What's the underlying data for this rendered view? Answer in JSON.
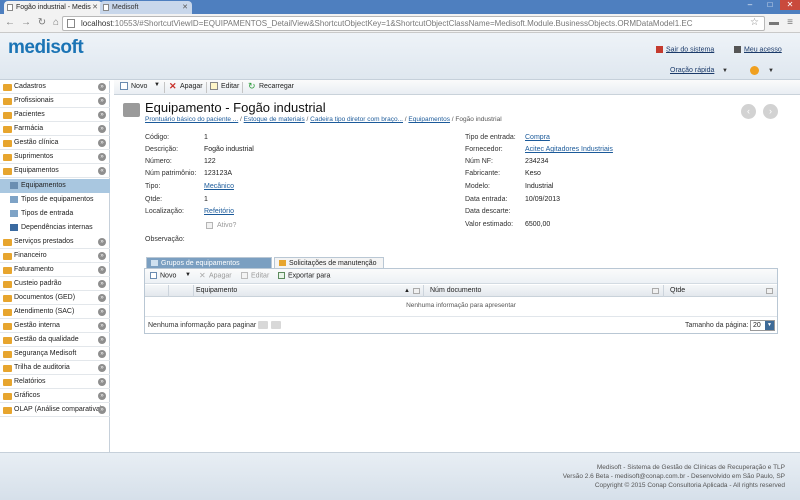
{
  "browser": {
    "tabs": [
      {
        "label": "Fogão industrial - Medis"
      },
      {
        "label": "Medisoft"
      }
    ],
    "url_host": "localhost",
    "url_rest": ":10553/#ShortcutViewID=EQUIPAMENTOS_DetailView&ShortcutObjectKey=1&ShortcutObjectClassName=Medisoft.Module.BusinessObjects.ORMDataModel1.EC"
  },
  "header": {
    "logo": "medisoft",
    "logout": "Sair do sistema",
    "account": "Meu acesso",
    "quick_prayer": "Oração rápida"
  },
  "sidebar": {
    "groups_top": [
      "Cadastros",
      "Profissionais",
      "Pacientes",
      "Farmácia",
      "Gestão clínica",
      "Suprimentos",
      "Equipamentos"
    ],
    "sub_items": [
      {
        "label": "Equipamentos",
        "selected": true
      },
      {
        "label": "Tipos de equipamentos",
        "selected": false
      },
      {
        "label": "Tipos de entrada",
        "selected": false
      },
      {
        "label": "Dependências internas",
        "selected": false
      }
    ],
    "groups_bottom": [
      "Serviços prestados",
      "Financeiro",
      "Faturamento",
      "Custeio padrão",
      "Documentos (GED)",
      "Atendimento (SAC)",
      "Gestão interna",
      "Gestão da qualidade",
      "Segurança Medisoft",
      "Trilha de auditoria",
      "Relatórios",
      "Gráficos",
      "OLAP (Análise comparativa)"
    ]
  },
  "toolbar": {
    "new": "Novo",
    "delete": "Apagar",
    "edit": "Editar",
    "reload": "Recarregar"
  },
  "page": {
    "title": "Equipamento - Fogão industrial",
    "breadcrumb": [
      "Prontuário básico do paciente ...",
      "Estoque de materiais",
      "Cadeira tipo diretor com braço...",
      "Equipamentos"
    ],
    "breadcrumb_current": "Fogão industrial"
  },
  "fields_left": [
    {
      "label": "Código:",
      "value": "1",
      "link": false
    },
    {
      "label": "Descrição:",
      "value": "Fogão industrial",
      "link": false
    },
    {
      "label": "Número:",
      "value": "122",
      "link": false
    },
    {
      "label": "Núm patrimônio:",
      "value": "123123A",
      "link": false
    },
    {
      "label": "Tipo:",
      "value": "Mecânico",
      "link": true
    },
    {
      "label": "Qtde:",
      "value": "1",
      "link": false
    },
    {
      "label": "Localização:",
      "value": "Refeitório",
      "link": true
    }
  ],
  "ativo_label": "Ativo?",
  "observacao_label": "Observação:",
  "fields_right": [
    {
      "label": "Tipo de entrada:",
      "value": "Compra",
      "link": true
    },
    {
      "label": "Fornecedor:",
      "value": "Acitec Agitadores Industriais",
      "link": true
    },
    {
      "label": "Núm NF:",
      "value": "234234",
      "link": false
    },
    {
      "label": "Fabricante:",
      "value": "Keso",
      "link": false
    },
    {
      "label": "Modelo:",
      "value": "Industrial",
      "link": false
    },
    {
      "label": "Data entrada:",
      "value": "10/09/2013",
      "link": false
    },
    {
      "label": "Data descarte:",
      "value": "",
      "link": false
    },
    {
      "label": "Valor estimado:",
      "value": "6500,00",
      "link": false
    }
  ],
  "subtabs": [
    "Grupos de equipamentos",
    "Solicitações de manutenção"
  ],
  "grid": {
    "toolbar": {
      "new": "Novo",
      "delete": "Apagar",
      "edit": "Editar",
      "export": "Exportar para"
    },
    "columns": [
      "Equipamento",
      "Núm documento",
      "Qtde"
    ],
    "empty": "Nenhuma informação para apresentar",
    "pager": "Nenhuma informação para paginar",
    "page_size_label": "Tamanho da página:",
    "page_size": "20"
  },
  "footer": {
    "line1": "Medisoft - Sistema de Gestão de Clínicas de Recuperação e TLP",
    "line2": "Versão 2.6 Beta - medisoft@conap.com.br - Desenvolvido em São Paulo, SP",
    "line3": "Copyright © 2015 Conap Consultoria Aplicada - All rights reserved"
  },
  "colors": {
    "brand": "#1b74b5",
    "selected_nav": "#a9c7e0",
    "folder_icon": "#e7a52e",
    "browser_frame": "#4e7fbf"
  }
}
